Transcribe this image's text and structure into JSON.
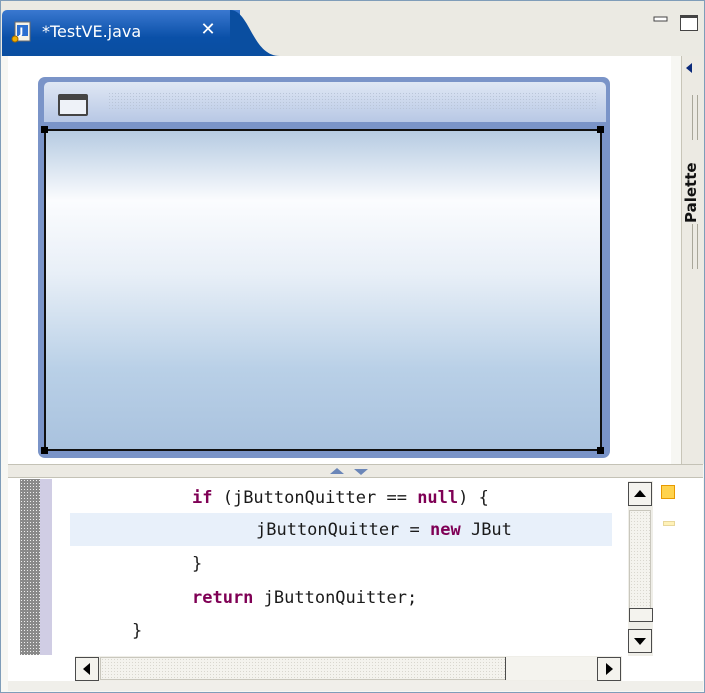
{
  "editor_tab": {
    "title": "*TestVE.java",
    "icon": "java-file-icon",
    "close_icon": "close-icon"
  },
  "view_controls": {
    "minimize_icon": "minimize-icon",
    "maximize_icon": "maximize-icon"
  },
  "palette": {
    "label": "Palette",
    "collapse_icon": "triangle-left-icon"
  },
  "designer": {
    "frame_icon": "window-icon"
  },
  "source": {
    "lines": [
      {
        "kw1": "if",
        "text1": " (jButtonQuitter == ",
        "kw2": "null",
        "text2": ") {"
      },
      {
        "text1": "jButtonQuitter = ",
        "kw": "new",
        "text2": " JBut"
      },
      {
        "text": "}"
      },
      {
        "kw": "return",
        "text": " jButtonQuitter;"
      },
      {
        "text": "}"
      }
    ]
  },
  "colors": {
    "tab_active": "#0a50a8",
    "keyword": "#7f0055",
    "current_line": "#e8f0fa",
    "overview_warning": "#ffd34d"
  }
}
